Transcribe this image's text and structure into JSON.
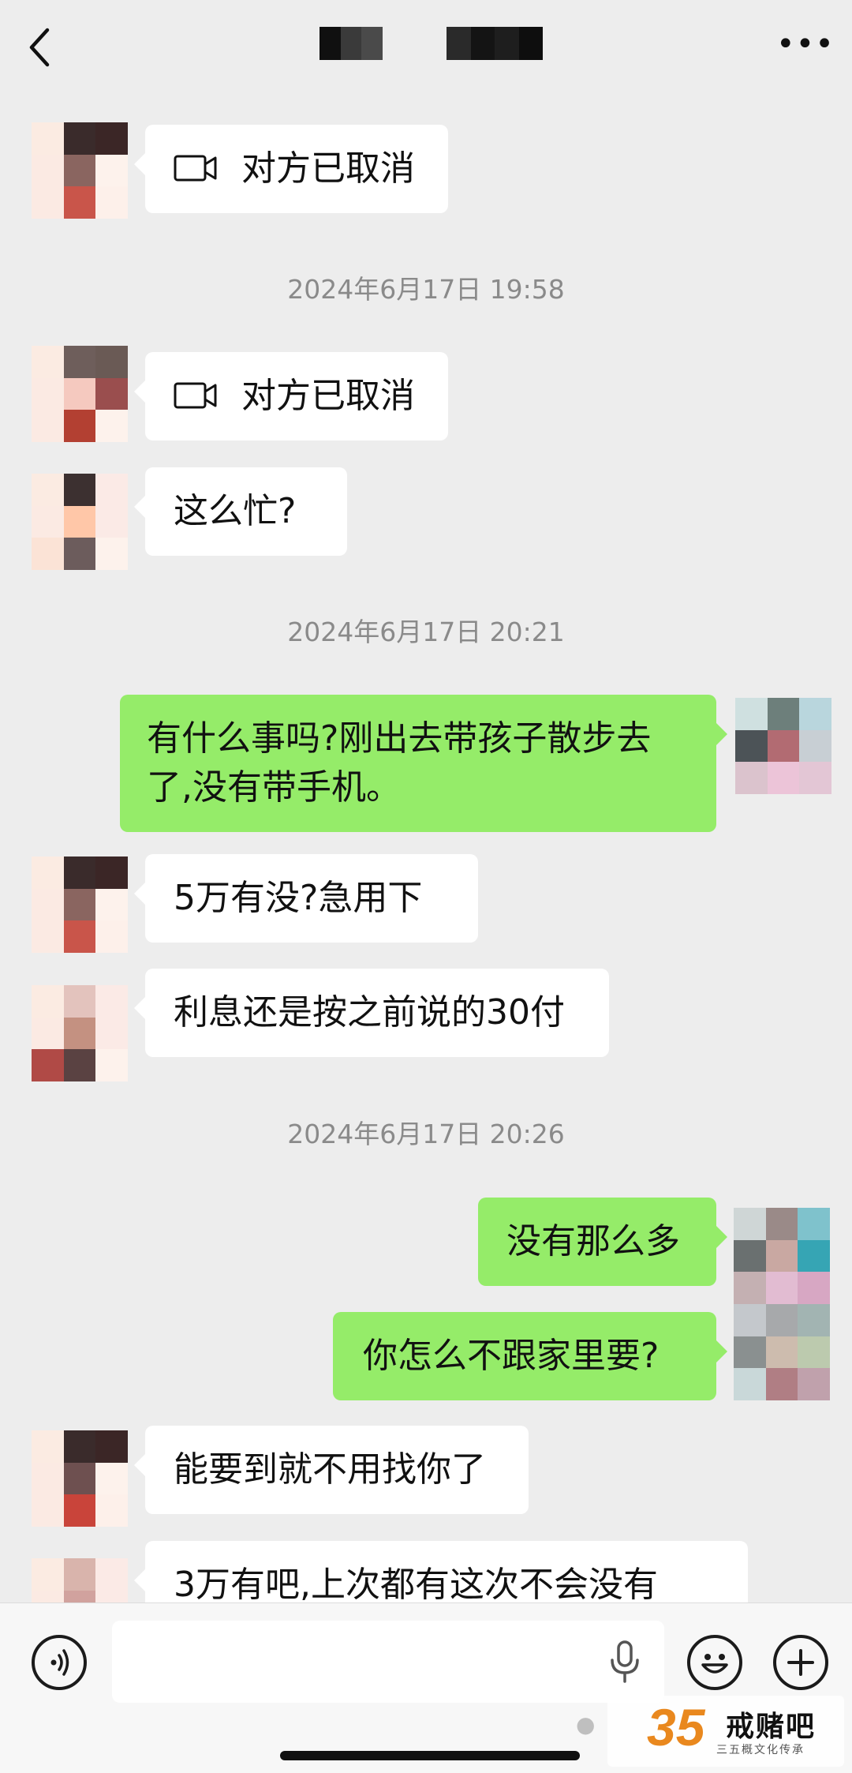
{
  "header": {
    "back_icon": "chevron-left-icon",
    "more_label": "•••"
  },
  "messages": [
    {
      "side": "in",
      "text": "对方已取消",
      "call_icon": "video-camera-icon"
    },
    {
      "time": "2024年6月17日 19:58"
    },
    {
      "side": "in",
      "text": "对方已取消",
      "call_icon": "video-camera-icon"
    },
    {
      "side": "in",
      "text": "这么忙?"
    },
    {
      "time": "2024年6月17日 20:21"
    },
    {
      "side": "out",
      "text": "有什么事吗?刚出去带孩子散步去了,没有带手机。"
    },
    {
      "side": "in",
      "text": "5万有没?急用下"
    },
    {
      "side": "in",
      "text": "利息还是按之前说的30付"
    },
    {
      "time": "2024年6月17日 20:26"
    },
    {
      "side": "out",
      "text": "没有那么多"
    },
    {
      "side": "out",
      "text": "你怎么不跟家里要?"
    },
    {
      "side": "in",
      "text": "能要到就不用找你了"
    },
    {
      "side": "in",
      "text": "3万有吧,上次都有这次不会没有"
    }
  ],
  "composer": {
    "voice_icon": "voice-icon",
    "mic_icon": "microphone-icon",
    "emoji_icon": "emoji-icon",
    "plus_icon": "plus-icon"
  },
  "watermark": {
    "number": "35",
    "brand": "戒赌吧",
    "subtitle": "三五概文化传承",
    "wechat_icon": "wechat-icon"
  },
  "colors": {
    "background": "#ededed",
    "incoming_bubble": "#ffffff",
    "outgoing_bubble": "#95ec69",
    "timestamp": "#8a8a8a"
  }
}
